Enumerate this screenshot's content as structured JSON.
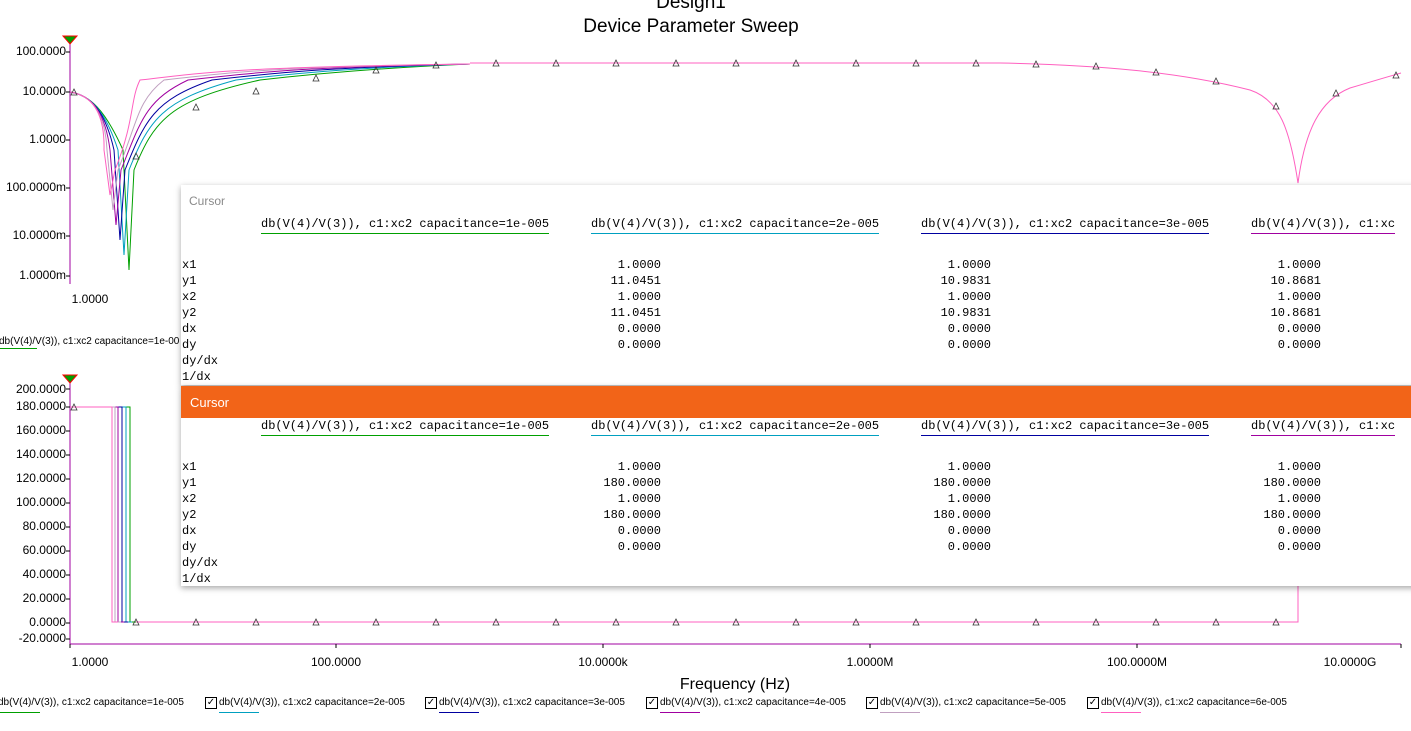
{
  "title": "Design1",
  "subtitle": "Device Parameter Sweep",
  "top_plot": {
    "y_ticks": [
      "100.0000",
      "10.0000",
      "1.0000",
      "100.0000m",
      "10.0000m",
      "1.0000m"
    ],
    "x_ticks": [
      "1.0000"
    ],
    "partial_legend": "db(V(4)/V(3)), c1:xc2 capacitance=1e-00"
  },
  "bottom_plot": {
    "y_ticks": [
      "200.0000",
      "180.0000",
      "160.0000",
      "140.0000",
      "120.0000",
      "100.0000",
      "80.0000",
      "60.0000",
      "40.0000",
      "20.0000",
      "0.0000",
      "-20.0000"
    ],
    "x_ticks": [
      "1.0000",
      "100.0000",
      "10.0000k",
      "1.0000M",
      "100.0000M",
      "10.0000G"
    ],
    "xlabel": "Frequency (Hz)"
  },
  "legend": [
    {
      "label": "db(V(4)/V(3)), c1:xc2 capacitance=1e-005",
      "color": "#00a000",
      "checkbox": false
    },
    {
      "label": "db(V(4)/V(3)), c1:xc2 capacitance=2e-005",
      "color": "#00a0c0",
      "checkbox": true
    },
    {
      "label": "db(V(4)/V(3)), c1:xc2 capacitance=3e-005",
      "color": "#0000a0",
      "checkbox": true
    },
    {
      "label": "db(V(4)/V(3)), c1:xc2 capacitance=4e-005",
      "color": "#a000a0",
      "checkbox": true
    },
    {
      "label": "db(V(4)/V(3)), c1:xc2 capacitance=5e-005",
      "color": "#c0a0c0",
      "checkbox": true
    },
    {
      "label": "db(V(4)/V(3)), c1:xc2 capacitance=6e-005",
      "color": "#ff60c0",
      "checkbox": true
    }
  ],
  "cursor1": {
    "title": "Cursor",
    "columns": [
      {
        "label": "db(V(4)/V(3)), c1:xc2 capacitance=1e-005",
        "color": "#00a000",
        "values": [
          "1.0000",
          "11.0451",
          "1.0000",
          "11.0451",
          "0.0000",
          "0.0000"
        ]
      },
      {
        "label": "db(V(4)/V(3)), c1:xc2 capacitance=2e-005",
        "color": "#00a0c0",
        "values": [
          "1.0000",
          "10.9831",
          "1.0000",
          "10.9831",
          "0.0000",
          "0.0000"
        ]
      },
      {
        "label": "db(V(4)/V(3)), c1:xc2 capacitance=3e-005",
        "color": "#0000a0",
        "values": [
          "1.0000",
          "10.8681",
          "1.0000",
          "10.8681",
          "0.0000",
          "0.0000"
        ]
      },
      {
        "label": "db(V(4)/V(3)), c1:xc",
        "color": "#a000a0",
        "values": []
      }
    ],
    "rows": [
      "x1",
      "y1",
      "x2",
      "y2",
      "dx",
      "dy",
      "dy/dx",
      "1/dx"
    ]
  },
  "cursor2": {
    "title": "Cursor",
    "columns": [
      {
        "label": "db(V(4)/V(3)), c1:xc2 capacitance=1e-005",
        "color": "#00a000",
        "values": [
          "1.0000",
          "180.0000",
          "1.0000",
          "180.0000",
          "0.0000",
          "0.0000"
        ]
      },
      {
        "label": "db(V(4)/V(3)), c1:xc2 capacitance=2e-005",
        "color": "#00a0c0",
        "values": [
          "1.0000",
          "180.0000",
          "1.0000",
          "180.0000",
          "0.0000",
          "0.0000"
        ]
      },
      {
        "label": "db(V(4)/V(3)), c1:xc2 capacitance=3e-005",
        "color": "#0000a0",
        "values": [
          "1.0000",
          "180.0000",
          "1.0000",
          "180.0000",
          "0.0000",
          "0.0000"
        ]
      },
      {
        "label": "db(V(4)/V(3)), c1:xc",
        "color": "#a000a0",
        "values": []
      }
    ],
    "rows": [
      "x1",
      "y1",
      "x2",
      "y2",
      "dx",
      "dy",
      "dy/dx",
      "1/dx"
    ]
  },
  "colors": {
    "axis": "#a000a0",
    "cursor_accent": "#f26418"
  }
}
